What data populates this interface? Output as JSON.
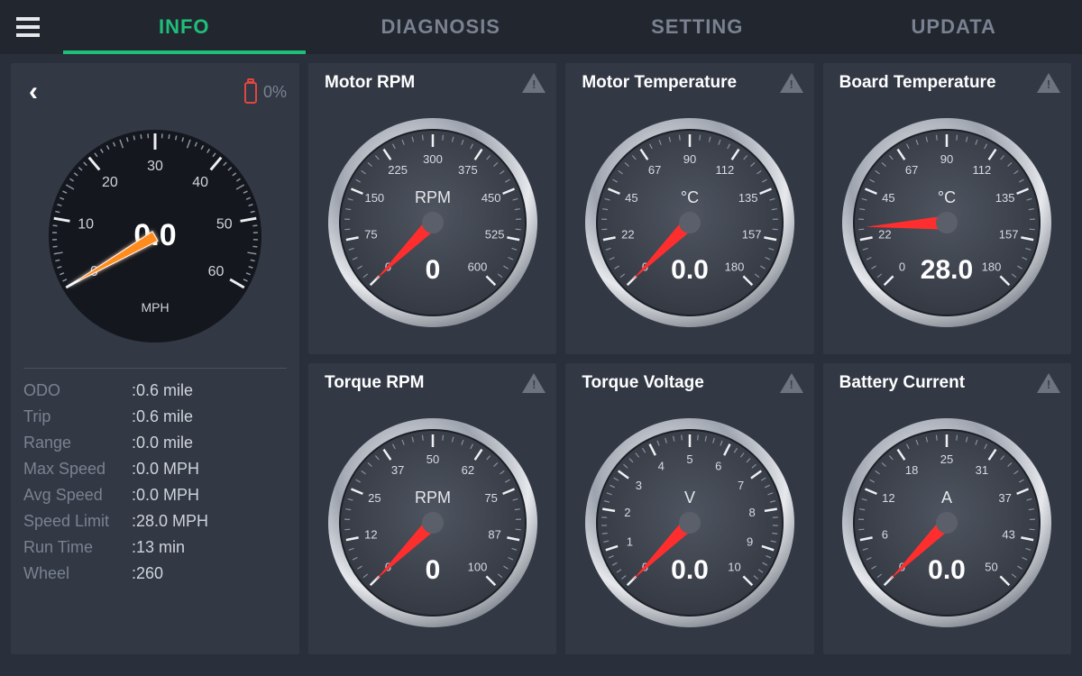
{
  "tabs": [
    "INFO",
    "DIAGNOSIS",
    "SETTING",
    "UPDATA"
  ],
  "active_tab": 0,
  "battery_pct": "0%",
  "speed": {
    "value": "0.0",
    "unit": "MPH",
    "ticks": [
      "0",
      "10",
      "20",
      "30",
      "40",
      "50",
      "60"
    ],
    "max": 60,
    "reading": 0
  },
  "stats": [
    {
      "k": "ODO",
      "v": "0.6",
      "u": "mile"
    },
    {
      "k": "Trip",
      "v": "0.6",
      "u": "mile"
    },
    {
      "k": "Range",
      "v": "0.0",
      "u": "mile"
    },
    {
      "k": "Max Speed",
      "v": "0.0",
      "u": "MPH"
    },
    {
      "k": "Avg Speed",
      "v": "0.0",
      "u": "MPH"
    },
    {
      "k": "Speed Limit",
      "v": "28.0",
      "u": "MPH"
    },
    {
      "k": "Run Time",
      "v": "13",
      "u": "min"
    },
    {
      "k": "Wheel",
      "v": "260",
      "u": ""
    }
  ],
  "gauges": [
    {
      "title": "Motor RPM",
      "unit": "RPM",
      "ticks": [
        "0",
        "75",
        "150",
        "225",
        "300",
        "375",
        "450",
        "525",
        "600"
      ],
      "max": 600,
      "value": 0,
      "display": "0"
    },
    {
      "title": "Motor Temperature",
      "unit": "°C",
      "ticks": [
        "0",
        "22",
        "45",
        "67",
        "90",
        "112",
        "135",
        "157",
        "180"
      ],
      "max": 180,
      "value": 0,
      "display": "0.0"
    },
    {
      "title": "Board Temperature",
      "unit": "°C",
      "ticks": [
        "0",
        "22",
        "45",
        "67",
        "90",
        "112",
        "135",
        "157",
        "180"
      ],
      "max": 180,
      "value": 28,
      "display": "28.0"
    },
    {
      "title": "Torque RPM",
      "unit": "RPM",
      "ticks": [
        "0",
        "12",
        "25",
        "37",
        "50",
        "62",
        "75",
        "87",
        "100"
      ],
      "max": 100,
      "value": 0,
      "display": "0"
    },
    {
      "title": "Torque Voltage",
      "unit": "V",
      "ticks": [
        "0",
        "1",
        "2",
        "3",
        "4",
        "5",
        "6",
        "7",
        "8",
        "9",
        "10"
      ],
      "max": 10,
      "value": 0,
      "display": "0.0"
    },
    {
      "title": "Battery Current",
      "unit": "A",
      "ticks": [
        "0",
        "6",
        "12",
        "18",
        "25",
        "31",
        "37",
        "43",
        "50"
      ],
      "max": 50,
      "value": 0,
      "display": "0.0"
    }
  ]
}
